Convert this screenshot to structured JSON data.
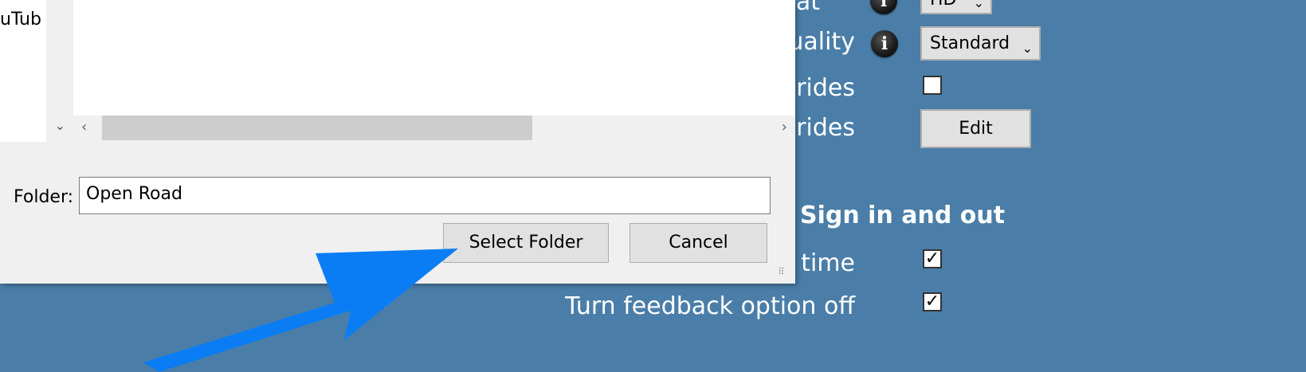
{
  "settings": {
    "rows": [
      {
        "label": "ormat",
        "control": "dropdown",
        "value": "HD"
      },
      {
        "label": "uality",
        "control": "dropdown",
        "value": "Standard"
      },
      {
        "label": "rides",
        "control": "checkbox",
        "checked": false
      },
      {
        "label": "rides",
        "control": "button",
        "button_label": "Edit"
      }
    ],
    "info_icon_glyph": "i",
    "section_heading": "Sign in and out",
    "section_rows": [
      {
        "label": "time",
        "checked": true
      },
      {
        "label": "Turn feedback option off",
        "checked": true
      }
    ]
  },
  "dialog": {
    "left_pane_text": "uTub",
    "folder_label": "Folder:",
    "folder_value": "Open Road",
    "select_button": "Select Folder",
    "cancel_button": "Cancel"
  },
  "glyphs": {
    "check": "✓",
    "chevron_down": "⌄",
    "chevron_left": "‹",
    "chevron_right": "›",
    "vchevron_down": "⌄"
  },
  "colors": {
    "background": "#4a7ea8",
    "arrow": "#0a7df5"
  }
}
